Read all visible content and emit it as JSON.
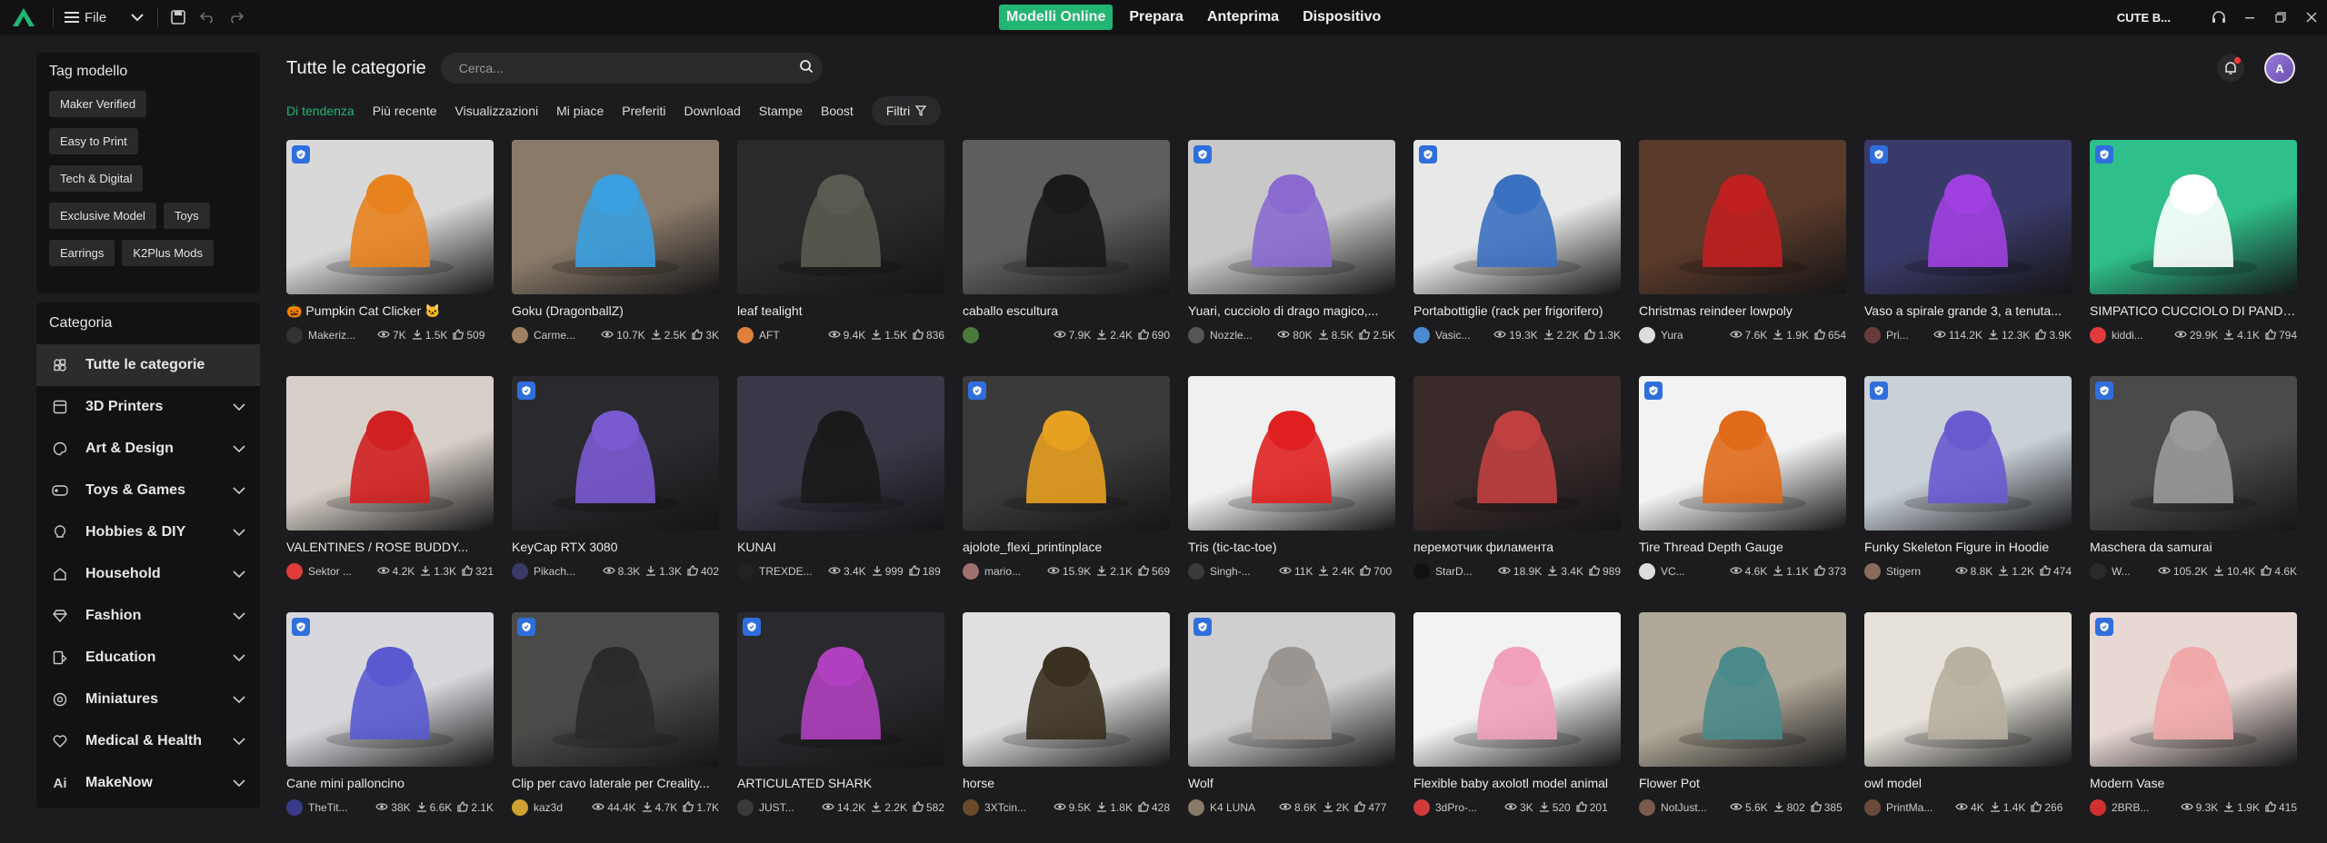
{
  "titlebar": {
    "file_label": "File",
    "tabs": [
      {
        "label": "Modelli Online",
        "active": true
      },
      {
        "label": "Prepara",
        "active": false
      },
      {
        "label": "Anteprima",
        "active": false
      },
      {
        "label": "Dispositivo",
        "active": false
      }
    ],
    "user_name": "CUTE B...",
    "accent": "#22b573"
  },
  "sidebar": {
    "tag_title": "Tag modello",
    "tags": [
      "Maker Verified",
      "Easy to Print",
      "Tech & Digital",
      "Exclusive Model",
      "Toys",
      "Earrings",
      "K2Plus Mods"
    ],
    "category_title": "Categoria",
    "categories": [
      {
        "label": "Tutte le categorie",
        "icon": "grid-icon",
        "active": true
      },
      {
        "label": "3D Printers",
        "icon": "printer-icon"
      },
      {
        "label": "Art & Design",
        "icon": "palette-icon"
      },
      {
        "label": "Toys & Games",
        "icon": "gamepad-icon"
      },
      {
        "label": "Hobbies & DIY",
        "icon": "bulb-icon"
      },
      {
        "label": "Household",
        "icon": "house-icon"
      },
      {
        "label": "Fashion",
        "icon": "diamond-icon"
      },
      {
        "label": "Education",
        "icon": "education-icon"
      },
      {
        "label": "Miniatures",
        "icon": "miniature-icon"
      },
      {
        "label": "Medical & Health",
        "icon": "heart-icon"
      },
      {
        "label": "MakeNow",
        "icon": "ai-icon"
      }
    ]
  },
  "main": {
    "title": "Tutte le categorie",
    "search_placeholder": "Cerca...",
    "avatar_letter": "A",
    "filters": [
      {
        "label": "Di tendenza",
        "active": true
      },
      {
        "label": "Più recente"
      },
      {
        "label": "Visualizzazioni"
      },
      {
        "label": "Mi piace"
      },
      {
        "label": "Preferiti"
      },
      {
        "label": "Download"
      },
      {
        "label": "Stampe"
      },
      {
        "label": "Boost"
      }
    ],
    "filter_button": "Filtri"
  },
  "models": [
    {
      "title": "🎃 Pumpkin Cat Clicker 🐱",
      "author": "Makeriz...",
      "views": "7K",
      "downloads": "1.5K",
      "likes": "509",
      "badge": true,
      "bg": "#d8d8d8",
      "fg": "#e8821f",
      "av": "#333333"
    },
    {
      "title": "Goku (DragonballZ)",
      "author": "Carme...",
      "views": "10.7K",
      "downloads": "2.5K",
      "likes": "3K",
      "badge": false,
      "bg": "#8a7a6a",
      "fg": "#3aa0e0",
      "av": "#a08060"
    },
    {
      "title": "leaf tealight",
      "author": "AFT",
      "views": "9.4K",
      "downloads": "1.5K",
      "likes": "836",
      "badge": false,
      "bg": "#2a2a2a",
      "fg": "#5a5a50",
      "av": "#e0803a"
    },
    {
      "title": "caballo escultura",
      "author": "",
      "views": "7.9K",
      "downloads": "2.4K",
      "likes": "690",
      "badge": false,
      "bg": "#5e5e5e",
      "fg": "#1a1a1a",
      "av": "#4a7a3a"
    },
    {
      "title": "Yuari, cucciolo di drago magico,...",
      "author": "Nozzle...",
      "views": "80K",
      "downloads": "8.5K",
      "likes": "2.5K",
      "badge": true,
      "bg": "#c8c8c8",
      "fg": "#8a6ad0",
      "av": "#555555"
    },
    {
      "title": "Portabottiglie (rack per frigorifero)",
      "author": "Vasic...",
      "views": "19.3K",
      "downloads": "2.2K",
      "likes": "1.3K",
      "badge": true,
      "bg": "#e8e8e8",
      "fg": "#3a70c0",
      "av": "#4a8ad0"
    },
    {
      "title": "Christmas reindeer lowpoly",
      "author": "Yura",
      "views": "7.6K",
      "downloads": "1.9K",
      "likes": "654",
      "badge": false,
      "bg": "#5a3a2a",
      "fg": "#c02020",
      "av": "#dddddd"
    },
    {
      "title": "Vaso a spirale grande 3, a tenuta...",
      "author": "Pri...",
      "views": "114.2K",
      "downloads": "12.3K",
      "likes": "3.9K",
      "badge": true,
      "bg": "#3a3a6a",
      "fg": "#a040e0",
      "av": "#6a3a3a"
    },
    {
      "title": "SIMPATICO CUCCIOLO DI PANDA...",
      "author": "kiddi...",
      "views": "29.9K",
      "downloads": "4.1K",
      "likes": "794",
      "badge": true,
      "bg": "#2fbf8a",
      "fg": "#ffffff",
      "av": "#e03a3a"
    },
    {
      "title": "VALENTINES / ROSE BUDDY...",
      "author": "Sektor ...",
      "views": "4.2K",
      "downloads": "1.3K",
      "likes": "321",
      "badge": false,
      "bg": "#d8d0c8",
      "fg": "#d02020",
      "av": "#e03a3a"
    },
    {
      "title": "KeyCap RTX 3080",
      "author": "Pikach...",
      "views": "8.3K",
      "downloads": "1.3K",
      "likes": "402",
      "badge": true,
      "bg": "#2a2a2e",
      "fg": "#7a5ad0",
      "av": "#3a3a6a"
    },
    {
      "title": "KUNAI",
      "author": "TREXDE...",
      "views": "3.4K",
      "downloads": "999",
      "likes": "189",
      "badge": false,
      "bg": "#3a3848",
      "fg": "#1a1a1a",
      "av": "#222222"
    },
    {
      "title": "ajolote_flexi_printinplace",
      "author": "mario...",
      "views": "15.9K",
      "downloads": "2.1K",
      "likes": "569",
      "badge": true,
      "bg": "#3a3a3a",
      "fg": "#e8a020",
      "av": "#a07070"
    },
    {
      "title": "Tris (tic-tac-toe)",
      "author": "Singh-...",
      "views": "11K",
      "downloads": "2.4K",
      "likes": "700",
      "badge": false,
      "bg": "#f0f0f0",
      "fg": "#e02020",
      "av": "#3a3a3a"
    },
    {
      "title": "перемотчик филамента",
      "author": "StarD...",
      "views": "18.9K",
      "downloads": "3.4K",
      "likes": "989",
      "badge": false,
      "bg": "#3a2a2a",
      "fg": "#c04040",
      "av": "#111111"
    },
    {
      "title": "Tire Thread Depth Gauge",
      "author": "VC...",
      "views": "4.6K",
      "downloads": "1.1K",
      "likes": "373",
      "badge": true,
      "bg": "#f2f2f2",
      "fg": "#e06a1a",
      "av": "#dddddd"
    },
    {
      "title": "Funky Skeleton Figure in Hoodie",
      "author": "Stigern",
      "views": "8.8K",
      "downloads": "1.2K",
      "likes": "474",
      "badge": true,
      "bg": "#c8d0d8",
      "fg": "#6a5ad0",
      "av": "#8a6a5a"
    },
    {
      "title": "Maschera da samurai",
      "author": "W...",
      "views": "105.2K",
      "downloads": "10.4K",
      "likes": "4.6K",
      "badge": true,
      "bg": "#4a4a4a",
      "fg": "#9a9a9a",
      "av": "#2a2a2a"
    },
    {
      "title": "Cane mini palloncino",
      "author": "TheTit...",
      "views": "38K",
      "downloads": "6.6K",
      "likes": "2.1K",
      "badge": true,
      "bg": "#d8d8dc",
      "fg": "#5a5ad0",
      "av": "#3a3a8a"
    },
    {
      "title": "Clip per cavo laterale per Creality...",
      "author": "kaz3d",
      "views": "44.4K",
      "downloads": "4.7K",
      "likes": "1.7K",
      "badge": true,
      "bg": "#4a4a48",
      "fg": "#2a2a2a",
      "av": "#d0a030"
    },
    {
      "title": "ARTICULATED SHARK",
      "author": "JUST...",
      "views": "14.2K",
      "downloads": "2.2K",
      "likes": "582",
      "badge": true,
      "bg": "#2a2a2e",
      "fg": "#b040c0",
      "av": "#3a3a3a"
    },
    {
      "title": "horse",
      "author": "3XTcin...",
      "views": "9.5K",
      "downloads": "1.8K",
      "likes": "428",
      "badge": false,
      "bg": "#e0e0e0",
      "fg": "#3a3020",
      "av": "#6a4a2a"
    },
    {
      "title": "Wolf",
      "author": "K4 LUNA",
      "views": "8.6K",
      "downloads": "2K",
      "likes": "477",
      "badge": true,
      "bg": "#cfcfcf",
      "fg": "#9a9590",
      "av": "#8a7a6a"
    },
    {
      "title": "Flexible baby axolotl model animal",
      "author": "3dPro-...",
      "views": "3K",
      "downloads": "520",
      "likes": "201",
      "badge": false,
      "bg": "#f2f2f2",
      "fg": "#f0a0b8",
      "av": "#d03a3a"
    },
    {
      "title": "Flower Pot",
      "author": "NotJust...",
      "views": "5.6K",
      "downloads": "802",
      "likes": "385",
      "badge": false,
      "bg": "#b0a898",
      "fg": "#4a8a8a",
      "av": "#7a5a4a"
    },
    {
      "title": "owl model",
      "author": "PrintMa...",
      "views": "4K",
      "downloads": "1.4K",
      "likes": "266",
      "badge": false,
      "bg": "#e6e2da",
      "fg": "#b8b0a0",
      "av": "#6a4a3a"
    },
    {
      "title": "Modern Vase",
      "author": "2BRB...",
      "views": "9.3K",
      "downloads": "1.9K",
      "likes": "415",
      "badge": true,
      "bg": "#e8d8d4",
      "fg": "#f0a8a8",
      "av": "#d03030"
    }
  ]
}
